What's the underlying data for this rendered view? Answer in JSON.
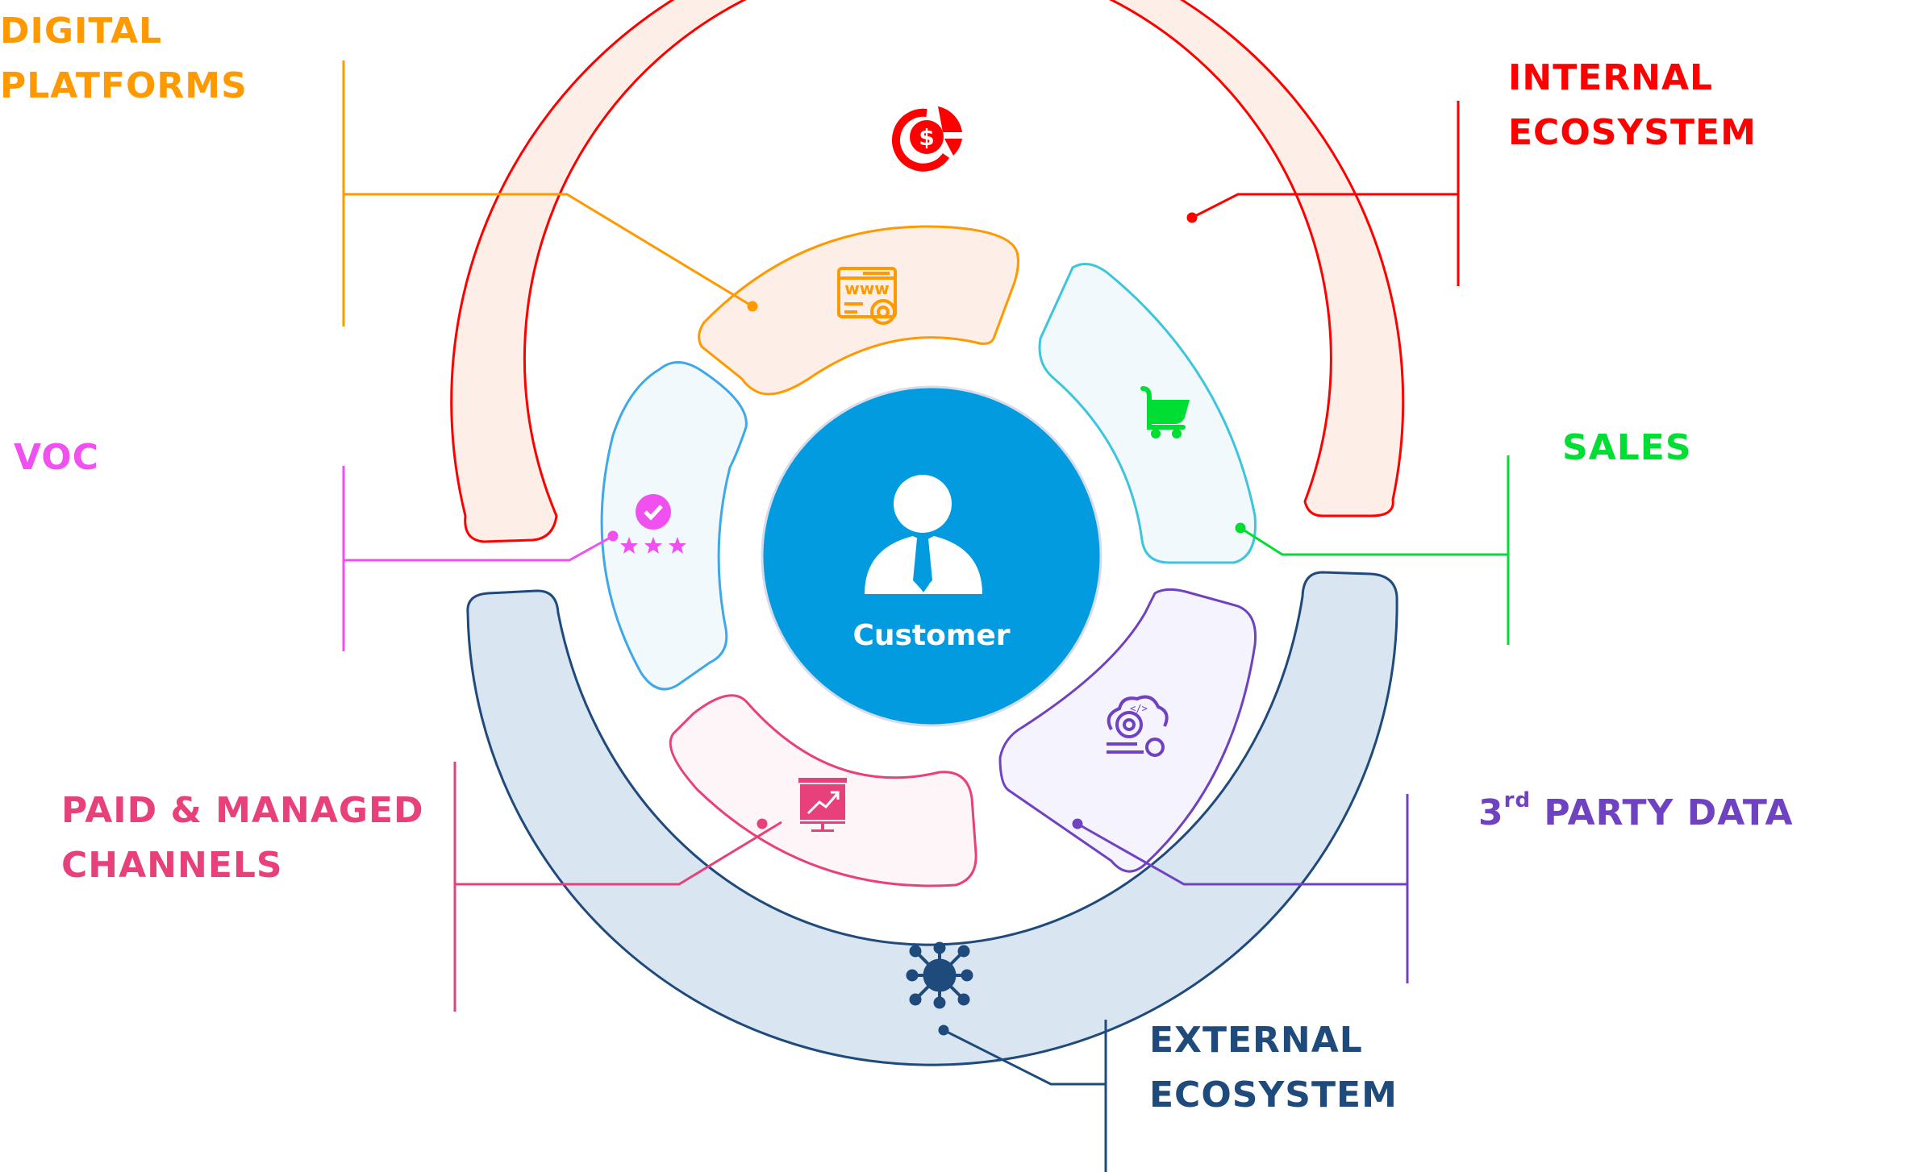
{
  "center": {
    "label": "Customer",
    "icon": "person-with-tie-icon",
    "color": "#039BE0"
  },
  "outer_rings": [
    {
      "id": "internal-ecosystem",
      "title_lines": [
        "INTERNAL",
        "ECOSYSTEM"
      ],
      "icon": "dollar-pie-chart-icon",
      "color": "#FF0000",
      "fill": "#FDEEE8"
    },
    {
      "id": "external-ecosystem",
      "title_lines": [
        "EXTERNAL",
        "ECOSYSTEM"
      ],
      "icon": "global-network-icon",
      "color": "#1F4A7C",
      "fill": "#D9E5F1"
    }
  ],
  "segments": [
    {
      "id": "digital-platforms",
      "title_lines": [
        "DIGITAL",
        "PLATFORMS"
      ],
      "icon": "website-settings-icon",
      "color": "#FF9900",
      "fill": "#FDEEE8"
    },
    {
      "id": "sales",
      "title_lines": [
        "SALES"
      ],
      "icon": "shopping-cart-icon",
      "color": "#00DD33",
      "stroke": "#3CC5DC",
      "fill": "#F2F9FD"
    },
    {
      "id": "third-party-data",
      "title_prefix": "3",
      "title_sup": "rd",
      "title_rest": " PARTY DATA",
      "icon": "cloud-gear-code-icon",
      "color": "#6F42C1",
      "fill": "#F5F3FD"
    },
    {
      "id": "paid-managed-channels",
      "title_lines": [
        "PAID & MANAGED",
        "CHANNELS"
      ],
      "icon": "presentation-growth-icon",
      "color": "#E8407A",
      "fill": "#FDF5F8"
    },
    {
      "id": "voc",
      "title_lines": [
        "VOC"
      ],
      "icon": "verified-rating-icon",
      "color": "#F050F0",
      "stroke": "#3EA8E8",
      "fill": "#F2F9FD"
    }
  ]
}
